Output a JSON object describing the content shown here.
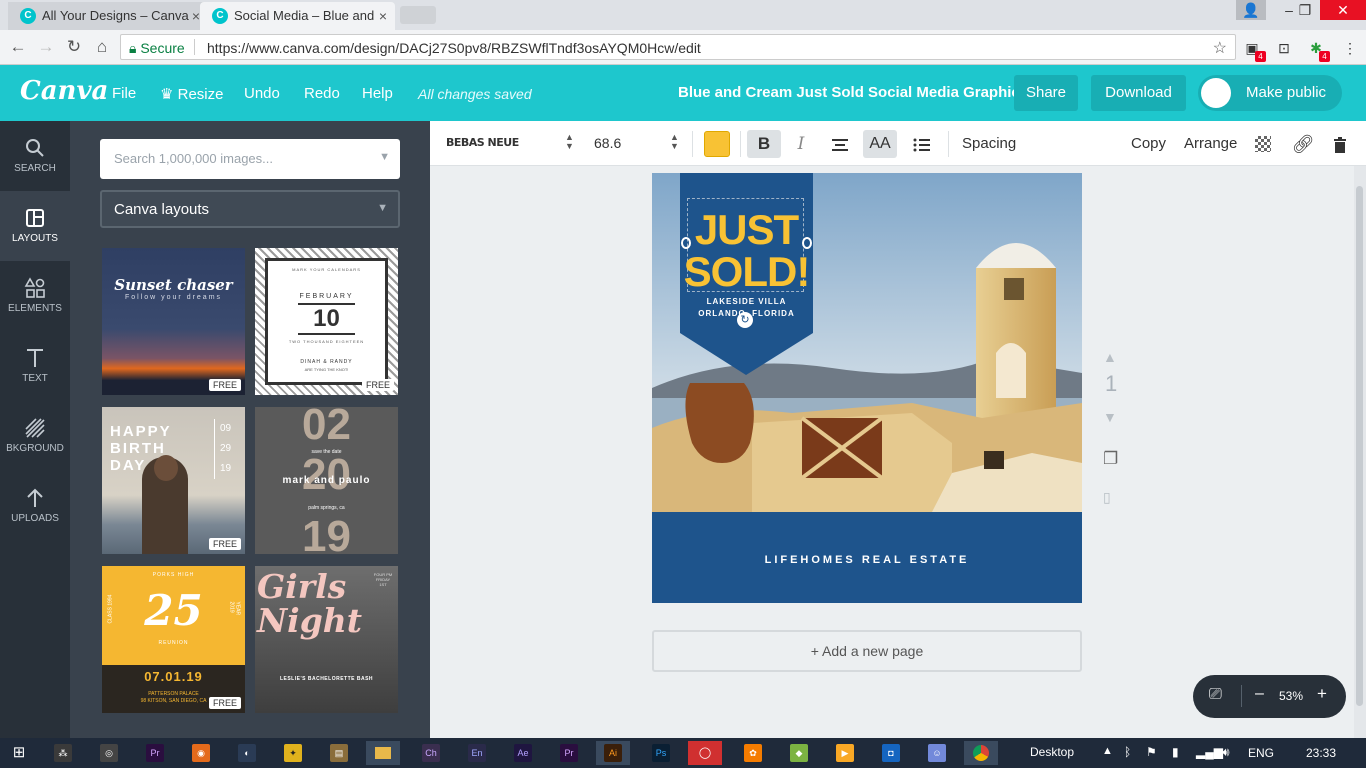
{
  "browser": {
    "tabs": [
      {
        "label": "All Your Designs – Canva"
      },
      {
        "label": "Social Media – Blue and C"
      }
    ],
    "secure_label": "Secure",
    "url": "https://www.canva.com/design/DACj27S0pv8/RBZSWflTndf3osAYQM0Hcw/edit",
    "extension_badge": "4"
  },
  "header": {
    "logo": "Canva",
    "menu": [
      "File",
      "Resize",
      "Undo",
      "Redo",
      "Help"
    ],
    "status": "All changes saved",
    "title": "Blue and Cream Just Sold Social Media Graphic",
    "share_label": "Share",
    "download_label": "Download",
    "make_public_label": "Make public"
  },
  "sidebar": {
    "items": [
      {
        "label": "SEARCH",
        "icon": "search-icon"
      },
      {
        "label": "LAYOUTS",
        "icon": "layouts-icon"
      },
      {
        "label": "ELEMENTS",
        "icon": "elements-icon"
      },
      {
        "label": "TEXT",
        "icon": "text-icon"
      },
      {
        "label": "BKGROUND",
        "icon": "background-icon"
      },
      {
        "label": "UPLOADS",
        "icon": "uploads-icon"
      }
    ]
  },
  "panel": {
    "search_placeholder": "Search 1,000,000 images...",
    "layout_select": "Canva layouts",
    "free_badge": "FREE",
    "thumbs": {
      "sunset_title": "Sunset chaser",
      "sunset_sub": "Follow your dreams",
      "calendar_top": "MARK YOUR CALENDARS",
      "calendar_month": "FEBRUARY",
      "calendar_day": "10",
      "calendar_year": "TWO THOUSAND EIGHTEEN",
      "calendar_names": "DINAH & RANDY",
      "calendar_sub": "ARE TYING THE KNOT!",
      "birthday_text": "HAPPY BIRTH DAY",
      "birthday_dates": [
        "09",
        "29",
        "19"
      ],
      "std_top": "02",
      "std_save": "save the date",
      "std_mid": "20",
      "std_names": "mark and paulo",
      "std_place": "palm springs, ca",
      "std_bottom": "19",
      "reunion_top": "PORKS HIGH",
      "reunion_num": "25",
      "reunion_class": "CLASS 1994",
      "reunion_year": "YEAR 2019",
      "reunion_word": "REUNION",
      "reunion_date": "07.01.19",
      "reunion_place": "PATTERSON PALACE",
      "reunion_addr": "98 KITSON, SAN DIEGO, CA",
      "girls_title": "Girls Night",
      "girls_right": "FOUR PM FRIDAY 1ST",
      "girls_event": "LESLIE'S BACHELORETTE BASH"
    }
  },
  "toolbar": {
    "font": "BEBAS NEUE",
    "font_size": "68.6",
    "text_color": "#f8c234",
    "bold": "B",
    "italic": "I",
    "case": "AA",
    "spacing": "Spacing",
    "copy": "Copy",
    "arrange": "Arrange"
  },
  "design": {
    "line1": "JUST",
    "line2": "SOLD!",
    "location1": "LAKESIDE VILLA",
    "location2": "ORLANDO, FLORIDA",
    "company": "LIFEHOMES REAL ESTATE",
    "banner_color": "#1e548c",
    "accent_color": "#f8c234"
  },
  "canvas": {
    "add_page": "+ Add a new page",
    "page_number": "1",
    "zoom": "53%"
  },
  "taskbar": {
    "desktop_label": "Desktop",
    "language": "ENG",
    "time": "23:33",
    "apps": [
      "Pr",
      "Ch",
      "En",
      "Ae",
      "Pr",
      "Ai",
      "Ps"
    ]
  }
}
